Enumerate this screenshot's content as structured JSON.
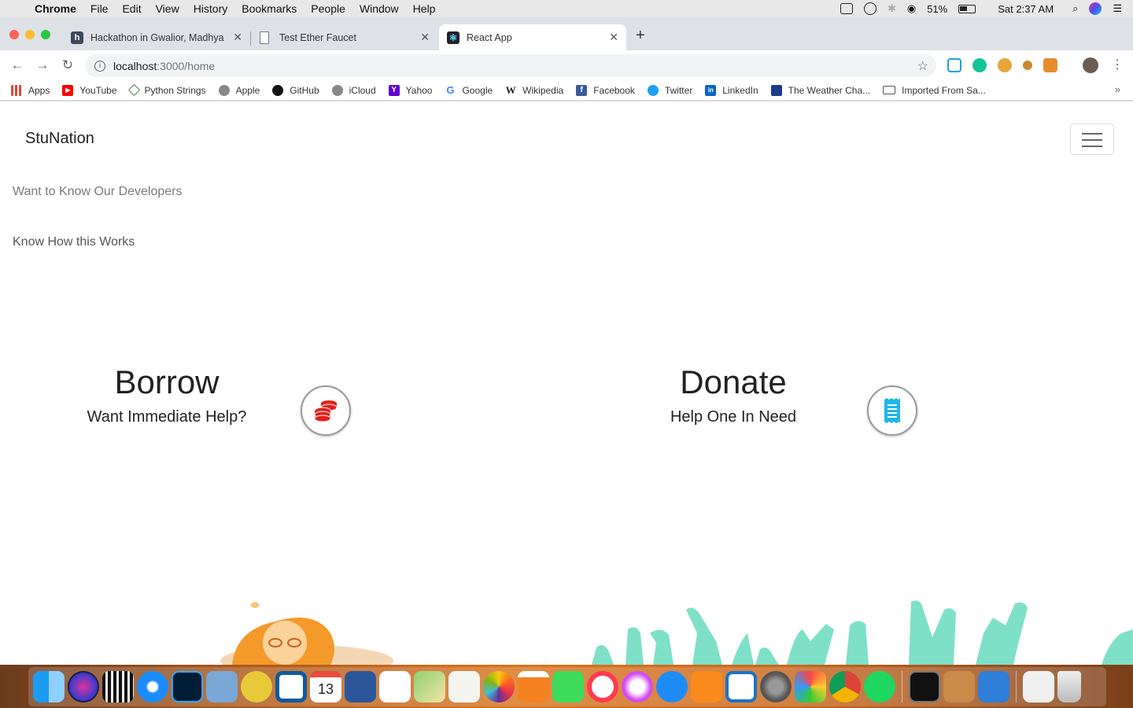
{
  "menubar": {
    "app": "Chrome",
    "items": [
      "File",
      "Edit",
      "View",
      "History",
      "Bookmarks",
      "People",
      "Window",
      "Help"
    ],
    "battery": "51%",
    "clock": "Sat 2:37 AM"
  },
  "tabs": [
    {
      "title": "Hackathon in Gwalior, Madhya",
      "favicon": "h",
      "favicon_color": "#3d4a5c"
    },
    {
      "title": "Test Ether Faucet",
      "favicon": "doc-icon",
      "favicon_color": "#888888"
    },
    {
      "title": "React App",
      "favicon": "react-icon",
      "favicon_color": "#20232a"
    }
  ],
  "omnibox": {
    "host": "localhost",
    "path": ":3000/home"
  },
  "bookmarks": [
    {
      "label": "Apps",
      "icon": "apps-grid-icon"
    },
    {
      "label": "YouTube",
      "icon": "youtube-icon"
    },
    {
      "label": "Python Strings",
      "icon": "python-icon"
    },
    {
      "label": "Apple",
      "icon": "apple-icon"
    },
    {
      "label": "GitHub",
      "icon": "github-icon"
    },
    {
      "label": "iCloud",
      "icon": "apple-icon"
    },
    {
      "label": "Yahoo",
      "icon": "yahoo-icon"
    },
    {
      "label": "Google",
      "icon": "google-icon"
    },
    {
      "label": "Wikipedia",
      "icon": "wikipedia-icon"
    },
    {
      "label": "Facebook",
      "icon": "facebook-icon"
    },
    {
      "label": "Twitter",
      "icon": "twitter-icon"
    },
    {
      "label": "LinkedIn",
      "icon": "linkedin-icon"
    },
    {
      "label": "The Weather Cha...",
      "icon": "weather-icon"
    },
    {
      "label": "Imported From Sa...",
      "icon": "folder-icon"
    }
  ],
  "page": {
    "brand": "StuNation",
    "links": {
      "developers": "Want to Know Our Developers",
      "how": "Know How this Works"
    },
    "borrow": {
      "title": "Borrow",
      "subtitle": "Want Immediate Help?",
      "icon": "coins-icon",
      "icon_color": "#e3201b"
    },
    "donate": {
      "title": "Donate",
      "subtitle": "Help One In Need",
      "icon": "receipt-icon",
      "icon_color": "#1fb6ea"
    }
  },
  "colors": {
    "accent_teal": "#7fe0c8",
    "tab_bar": "#dee1e6"
  },
  "dock": {
    "apps": [
      "finder",
      "siri",
      "piano",
      "safari",
      "photoshop",
      "preview",
      "genie",
      "calendar",
      "word",
      "notes",
      "maps",
      "textedit",
      "photos",
      "vlc",
      "facetime",
      "news",
      "music",
      "app-store",
      "books",
      "migration",
      "system-preferences",
      "pinwheel",
      "chrome",
      "spotify",
      "terminal",
      "box",
      "xcode",
      "screenshot",
      "trash"
    ],
    "calendar_month": "APR",
    "calendar_day": "13"
  }
}
